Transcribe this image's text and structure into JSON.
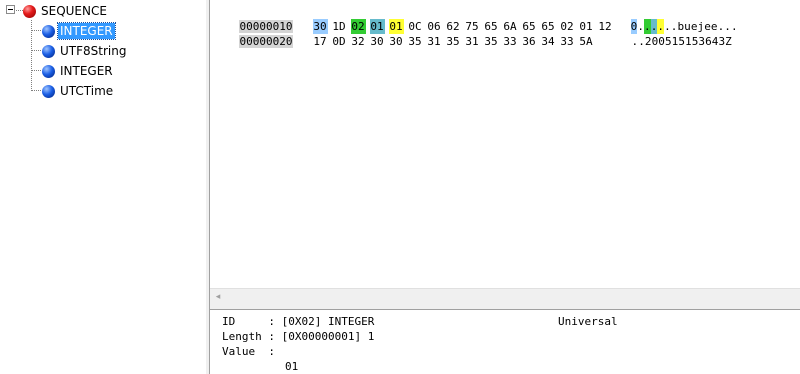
{
  "tree": {
    "root": {
      "label": "SEQUENCE",
      "icon": "red-ball-icon",
      "expanded": true
    },
    "children": [
      {
        "label": "INTEGER",
        "icon": "blue-ball-icon",
        "selected": true
      },
      {
        "label": "UTF8String",
        "icon": "blue-ball-icon",
        "selected": false
      },
      {
        "label": "INTEGER",
        "icon": "blue-ball-icon",
        "selected": false
      },
      {
        "label": "UTCTime",
        "icon": "blue-ball-icon",
        "selected": false
      }
    ]
  },
  "hex": {
    "rows": [
      {
        "offset": "00000010",
        "bytes": [
          "30",
          "1D",
          "02",
          "01",
          "01",
          "0C",
          "06",
          "62",
          "75",
          "65",
          "6A",
          "65",
          "65",
          "02",
          "01",
          "12"
        ],
        "ascii": [
          "0",
          ".",
          ".",
          ".",
          ".",
          ".",
          ".",
          "b",
          "u",
          "e",
          "j",
          "e",
          "e",
          ".",
          ".",
          "."
        ]
      },
      {
        "offset": "00000020",
        "bytes": [
          "17",
          "0D",
          "32",
          "30",
          "30",
          "35",
          "31",
          "35",
          "31",
          "35",
          "33",
          "36",
          "34",
          "33",
          "5A"
        ],
        "ascii": [
          ".",
          ".",
          "2",
          "0",
          "0",
          "5",
          "1",
          "5",
          "1",
          "5",
          "3",
          "6",
          "4",
          "3",
          "Z"
        ]
      }
    ],
    "highlight_colors": {
      "tag_seq": "#99ccff",
      "tag": "#33cc33",
      "length": "#66bbcc",
      "value": "#ffff33"
    }
  },
  "detail": {
    "id_label": "ID",
    "id_value": "[0X02] INTEGER",
    "class": "Universal",
    "length_label": "Length",
    "length_value": "[0X00000001] 1",
    "value_label": "Value",
    "value_data": "01"
  }
}
